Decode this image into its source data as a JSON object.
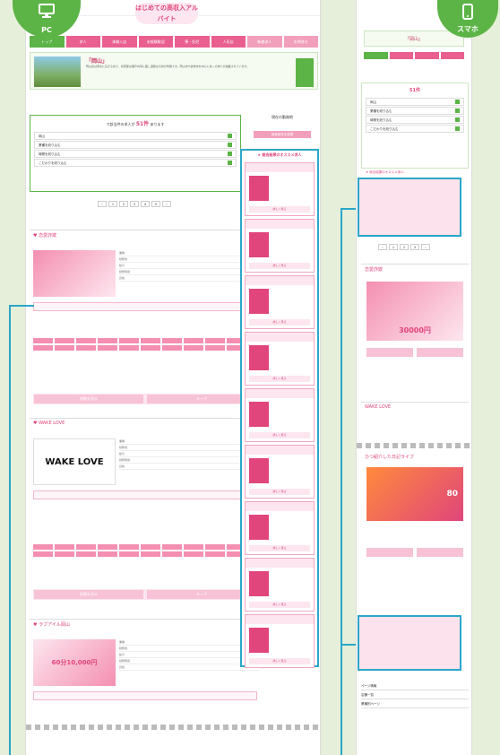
{
  "badges": {
    "pc": "PC",
    "sp": "スマホ"
  },
  "site": {
    "logo": "はじめての高収入アルバイト",
    "region_title": "「岡山」",
    "search_count_label": "で該当件の求人が",
    "count": "51件",
    "count_suffix": "あります"
  },
  "nav": {
    "items": [
      "トップ",
      "求人",
      "体験入店",
      "未経験歓迎",
      "寮・託児",
      "人気店",
      "新着求人",
      "お問合せ"
    ]
  },
  "banner": {
    "title": "「岡山」",
    "text": "岡山県は南北に広がる県で、県南部は瀬戸内海に面し温暖な気候が特徴です。岡山市や倉敷市を中心に多くの求人が掲載されています。"
  },
  "search": {
    "rows": [
      "岡山",
      "業種を絞り込む",
      "時間を絞り込む",
      "こだわりを絞り込む"
    ]
  },
  "side": {
    "title": "現在の勤務地",
    "button": "検索条件を変更"
  },
  "rec": {
    "title": "★ 総合結果のオススメ求人",
    "more": "詳しく見る"
  },
  "listings": [
    {
      "title": "♥ 恋愛詐欺",
      "rows": [
        "業種",
        "勤務地",
        "給与",
        "勤務時間",
        "資格"
      ]
    },
    {
      "title": "♥ WAKE LOVE",
      "banner": "WAKE LOVE",
      "rows": [
        "業種",
        "勤務地",
        "給与",
        "勤務時間",
        "資格"
      ]
    },
    {
      "title": "♥ ラブアイル岡山",
      "price": "60分10,000円",
      "rows": [
        "業種",
        "勤務地",
        "給与",
        "勤務時間",
        "資格"
      ]
    }
  ],
  "buttons": {
    "detail": "詳細を見る",
    "keep": "キープ"
  },
  "sp": {
    "title": "「岡山」",
    "count": "51件",
    "rec_title": "★ 総合結果のオススメ求人",
    "listing1": "恋愛詐欺",
    "listing2": "WAKE LOVE",
    "listing3": "ひつ紹介した日記ライブ",
    "price": "30000円",
    "price2": "80",
    "footer": [
      "ページ情報",
      "店舗一覧",
      "業種別ページ"
    ]
  },
  "colors": {
    "green": "#5cb446",
    "pink": "#e0457b",
    "blue": "#2aa7c9"
  }
}
